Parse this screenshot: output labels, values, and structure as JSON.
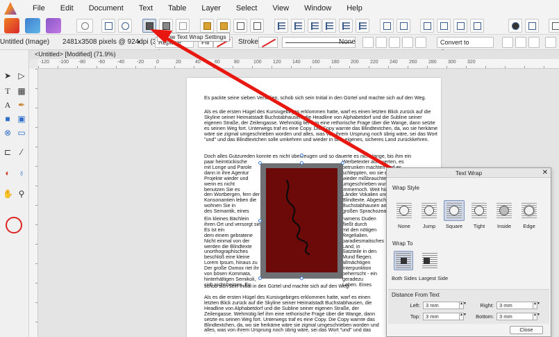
{
  "menu": [
    "File",
    "Edit",
    "Document",
    "Text",
    "Table",
    "Layer",
    "Select",
    "View",
    "Window",
    "Help"
  ],
  "tooltip": "Show Text Wrap Settings",
  "context": {
    "doc_label": "Untitled (Image)",
    "dims": "2481x3508 pixels @ 924dpi (32%)",
    "replace_image": "Replace Image",
    "fill": "Fill",
    "stroke_label": "Stroke:",
    "stroke_value": "None",
    "convert": "Convert to Curves"
  },
  "tab": "<Untitled> [Modified] (71.9%)",
  "ruler_marks": [
    "-120",
    "-100",
    "-80",
    "-60",
    "-40",
    "-20",
    "0",
    "20",
    "40",
    "60",
    "80",
    "100",
    "120",
    "140",
    "160",
    "180",
    "200",
    "220",
    "240",
    "260",
    "280",
    "300",
    "320"
  ],
  "doc": {
    "p1": "Es packte seine sieben Versalien, schob sich sein Initial in den Gürtel und machte sich auf den Weg.",
    "p2": "Als es die ersten Hügel des Kursivgebirges erklommen hatte, warf es einen letzten Blick zurück auf die Skyline seiner Heimatstadt Buchstabhausen, die Headline von Alphabetdorf und die Subline seiner eigenen Straße, der Zeilengasse. Wehmütig lief ihm eine rethorische Frage über die Wange, dann setzte es seinen Weg fort. Unterwegs traf es eine Copy. Die Copy warnte das Blindtextchen, da, wo sie herkäme wäre sie zigmal umgeschrieben worden und alles, was von ihrem Ursprung noch übrig wäre, sei das Wort \"und\" und das Blindtextchen solle umkehren und wieder in sein eigenes, sicheres Land zurückkehren.",
    "p3": "Doch alles Gutzureden konnte es nicht überzeugen und so dauerte es nicht lange, bis ihm ein",
    "left_col": "paar heimtückische\nmit Longe und Parole\ndann in ihre Agentur\nProjekte wieder und\nwenn es nicht\nbenutzen Sie es\nden Wortbergen, fern der\nKonsonantien leben die\nwohnen Sie in\ndes Semantik, eines",
    "right_col": "Werbetexter auflauerten, es\nbetrunken machten und es\nschleppten, wo sie es für ihre\nwieder mißbrauchten. Und\numgeschrieben wurde, dann\nimmernoch. Weit hinten, hinter\nLänder Vokalien und\nBlindtexte. Abgeschieden\nBuchstabhausen an der Küste\ngroßen Sprachozeans.",
    "left_col2": "Ein kleines Bächlein\nihren Ort und versorgt sie\nEs ist ein\ndem einem gebratene\nNicht einmal von der\nwerden die Blindtexte\nunorthographisches\nbeschloß eine kleine\nLorem Ipsum, hinaus zu\nDer große Oxmox riet ihr\nvon bösen Kommata,\nhinterhältigen Semikoli,\nsich nicht beirren. Es",
    "right_col2": "namens Duden fließt durch\nmit den nötigen Regelialien.\nparadiesmatisches Land, in\nSatzteile in den Mund fliegen.\nallmächtigen Interpunktion\nbeherrscht - ein geradezu\nLeben. Eines Tages aber\nZeile Blindtext namens\ngehen in die weite Grammatik.\ndavon ab, da es dort wimmele\nwilden Fragezeichen und\ndoch das Blindtextchen ließ\npackte seine sieben Versalien,",
    "p4": "schob sich sein Initial in den Gürtel und machte sich auf den Weg.",
    "p5": "Als es die ersten Hügel des Kursivgebirges erklommen hatte, warf es einen letzten Blick zurück auf die Skyline seiner Heimatstadt Buchstabhausen, die Headline von Alphabetdorf und die Subline seiner eigenen Straße, der Zeilengasse. Wehmütig lief ihm eine rethorische Frage über die Wange, dann setzte es seinen Weg fort. Unterwegs traf es eine Copy. Die Copy warnte das Blindtextchen, da, wo sie herkäme wäre sie zigmal umgeschrieben worden und alles, was von ihrem Ursprung noch übrig wäre, sei das Wort \"und\" und das Blindtextchen solle umkehren und wieder in sein eigenes, sicheres Land zurückkehren."
  },
  "dialog": {
    "title": "Text Wrap",
    "wrap_style_label": "Wrap Style",
    "styles": [
      "None",
      "Jump",
      "Square",
      "Tight",
      "Inside",
      "Edge"
    ],
    "selected_style": "Square",
    "wrap_to_label": "Wrap To",
    "wrap_to": [
      "Both Sides",
      "Largest Side"
    ],
    "selected_wrap_to": "Both Sides",
    "distance_label": "Distance From Text",
    "left_label": "Left:",
    "left_value": "3 mm",
    "top_label": "Top:",
    "top_value": "3 mm",
    "right_label": "Right:",
    "right_value": "3 mm",
    "bottom_label": "Bottom:",
    "bottom_value": "3 mm",
    "close_label": "Close"
  },
  "colors": {
    "accent_red": "#e8170f",
    "image_fill": "#6b0a08",
    "selection_blue": "#3a78d6"
  },
  "icons": [
    "select-tool-icon",
    "node-tool-icon",
    "text-tool-icon",
    "frame-text-icon",
    "pen-tool-icon",
    "shape-tool-icon",
    "picture-frame-icon",
    "crop-tool-icon",
    "color-picker-icon",
    "fill-tool-icon",
    "hand-tool-icon",
    "zoom-tool-icon",
    "place-image-icon"
  ]
}
